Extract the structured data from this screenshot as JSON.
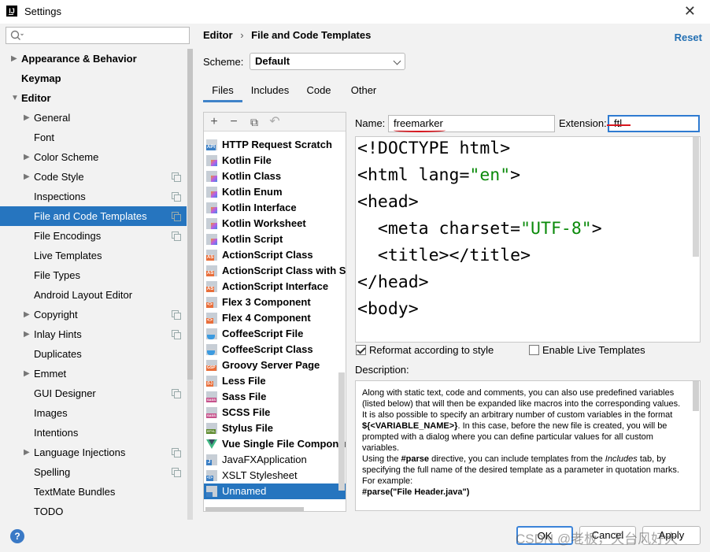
{
  "window": {
    "title": "Settings"
  },
  "search": {
    "placeholder": ""
  },
  "sidebar": {
    "items": [
      {
        "label": "Appearance & Behavior",
        "level": 0,
        "arrow": "collapsed",
        "bold": true
      },
      {
        "label": "Keymap",
        "level": 0,
        "bold": true
      },
      {
        "label": "Editor",
        "level": 0,
        "arrow": "expanded",
        "bold": true
      },
      {
        "label": "General",
        "level": 1,
        "arrow": "collapsed"
      },
      {
        "label": "Font",
        "level": 1
      },
      {
        "label": "Color Scheme",
        "level": 1,
        "arrow": "collapsed"
      },
      {
        "label": "Code Style",
        "level": 1,
        "arrow": "collapsed",
        "copy": true
      },
      {
        "label": "Inspections",
        "level": 1,
        "copy": true
      },
      {
        "label": "File and Code Templates",
        "level": 1,
        "copy": true,
        "selected": true
      },
      {
        "label": "File Encodings",
        "level": 1,
        "copy": true
      },
      {
        "label": "Live Templates",
        "level": 1
      },
      {
        "label": "File Types",
        "level": 1
      },
      {
        "label": "Android Layout Editor",
        "level": 1
      },
      {
        "label": "Copyright",
        "level": 1,
        "arrow": "collapsed",
        "copy": true
      },
      {
        "label": "Inlay Hints",
        "level": 1,
        "arrow": "collapsed",
        "copy": true
      },
      {
        "label": "Duplicates",
        "level": 1
      },
      {
        "label": "Emmet",
        "level": 1,
        "arrow": "collapsed"
      },
      {
        "label": "GUI Designer",
        "level": 1,
        "copy": true
      },
      {
        "label": "Images",
        "level": 1
      },
      {
        "label": "Intentions",
        "level": 1
      },
      {
        "label": "Language Injections",
        "level": 1,
        "arrow": "collapsed",
        "copy": true
      },
      {
        "label": "Spelling",
        "level": 1,
        "copy": true
      },
      {
        "label": "TextMate Bundles",
        "level": 1
      },
      {
        "label": "TODO",
        "level": 1
      }
    ]
  },
  "breadcrumb": {
    "parent": "Editor",
    "separator": "›",
    "current": "File and Code Templates"
  },
  "reset_label": "Reset",
  "scheme": {
    "label": "Scheme:",
    "value": "Default"
  },
  "tabs": [
    {
      "label": "Files",
      "active": true
    },
    {
      "label": "Includes"
    },
    {
      "label": "Code"
    },
    {
      "label": "Other"
    }
  ],
  "toolbar": {
    "add": "+",
    "remove": "−",
    "copy": "⧉",
    "reset": "↶"
  },
  "templates": [
    {
      "label": "HTTP Request Scratch",
      "icon": "api"
    },
    {
      "label": "Kotlin File",
      "icon": "kt"
    },
    {
      "label": "Kotlin Class",
      "icon": "kt"
    },
    {
      "label": "Kotlin Enum",
      "icon": "kt"
    },
    {
      "label": "Kotlin Interface",
      "icon": "kt"
    },
    {
      "label": "Kotlin Worksheet",
      "icon": "kt"
    },
    {
      "label": "Kotlin Script",
      "icon": "kt"
    },
    {
      "label": "ActionScript Class",
      "icon": "as"
    },
    {
      "label": "ActionScript Class with Su",
      "icon": "as"
    },
    {
      "label": "ActionScript Interface",
      "icon": "as"
    },
    {
      "label": "Flex 3 Component",
      "icon": "flex"
    },
    {
      "label": "Flex 4 Component",
      "icon": "flex"
    },
    {
      "label": "CoffeeScript File",
      "icon": "coffee"
    },
    {
      "label": "CoffeeScript Class",
      "icon": "coffee"
    },
    {
      "label": "Groovy Server Page",
      "icon": "gsp"
    },
    {
      "label": "Less File",
      "icon": "less"
    },
    {
      "label": "Sass File",
      "icon": "sass"
    },
    {
      "label": "SCSS File",
      "icon": "sass"
    },
    {
      "label": "Stylus File",
      "icon": "styl"
    },
    {
      "label": "Vue Single File Componer",
      "icon": "vue"
    },
    {
      "label": "JavaFXApplication",
      "icon": "java",
      "plain": true
    },
    {
      "label": "XSLT Stylesheet",
      "icon": "xslt",
      "plain": true
    },
    {
      "label": "Unnamed",
      "icon": "unnamed",
      "plain": true,
      "selected": true
    }
  ],
  "name_field": {
    "label": "Name:",
    "value": "freemarker"
  },
  "extension_field": {
    "label": "Extension:",
    "value": "ftl"
  },
  "code": {
    "lines": [
      [
        {
          "t": "<!DOCTYPE html>"
        }
      ],
      [
        {
          "t": "<html lang="
        },
        {
          "t": "\"en\"",
          "s": true
        },
        {
          "t": ">"
        }
      ],
      [
        {
          "t": "<head>"
        }
      ],
      [
        {
          "t": "  <meta charset="
        },
        {
          "t": "\"UTF-8\"",
          "s": true
        },
        {
          "t": ">"
        }
      ],
      [
        {
          "t": "  <title></title>"
        }
      ],
      [
        {
          "t": "</head>"
        }
      ],
      [
        {
          "t": "<body>"
        }
      ]
    ]
  },
  "reformat": {
    "label": "Reformat according to style",
    "checked": true
  },
  "live_templates": {
    "label": "Enable Live Templates",
    "checked": false
  },
  "description": {
    "label": "Description:",
    "p1": "Along with static text, code and comments, you can also use predefined variables (listed below) that will then be expanded like macros into the corresponding values.",
    "p2a": "It is also possible to specify an arbitrary number of custom variables in the format ",
    "p2b": "${<VARIABLE_NAME>}",
    "p2c": ". In this case, before the new file is created, you will be prompted with a dialog where you can define particular values for all custom variables.",
    "p3a": "Using the ",
    "p3b": "#parse",
    "p3c": " directive, you can include templates from the ",
    "p3d": "Includes",
    "p3e": " tab, by specifying the full name of the desired template as a parameter in quotation marks. For example:",
    "p4": "#parse(\"File Header.java\")"
  },
  "buttons": {
    "ok": "OK",
    "cancel": "Cancel",
    "apply": "Apply",
    "help": "?"
  },
  "watermark": "CSDN @老板，天台风好大"
}
